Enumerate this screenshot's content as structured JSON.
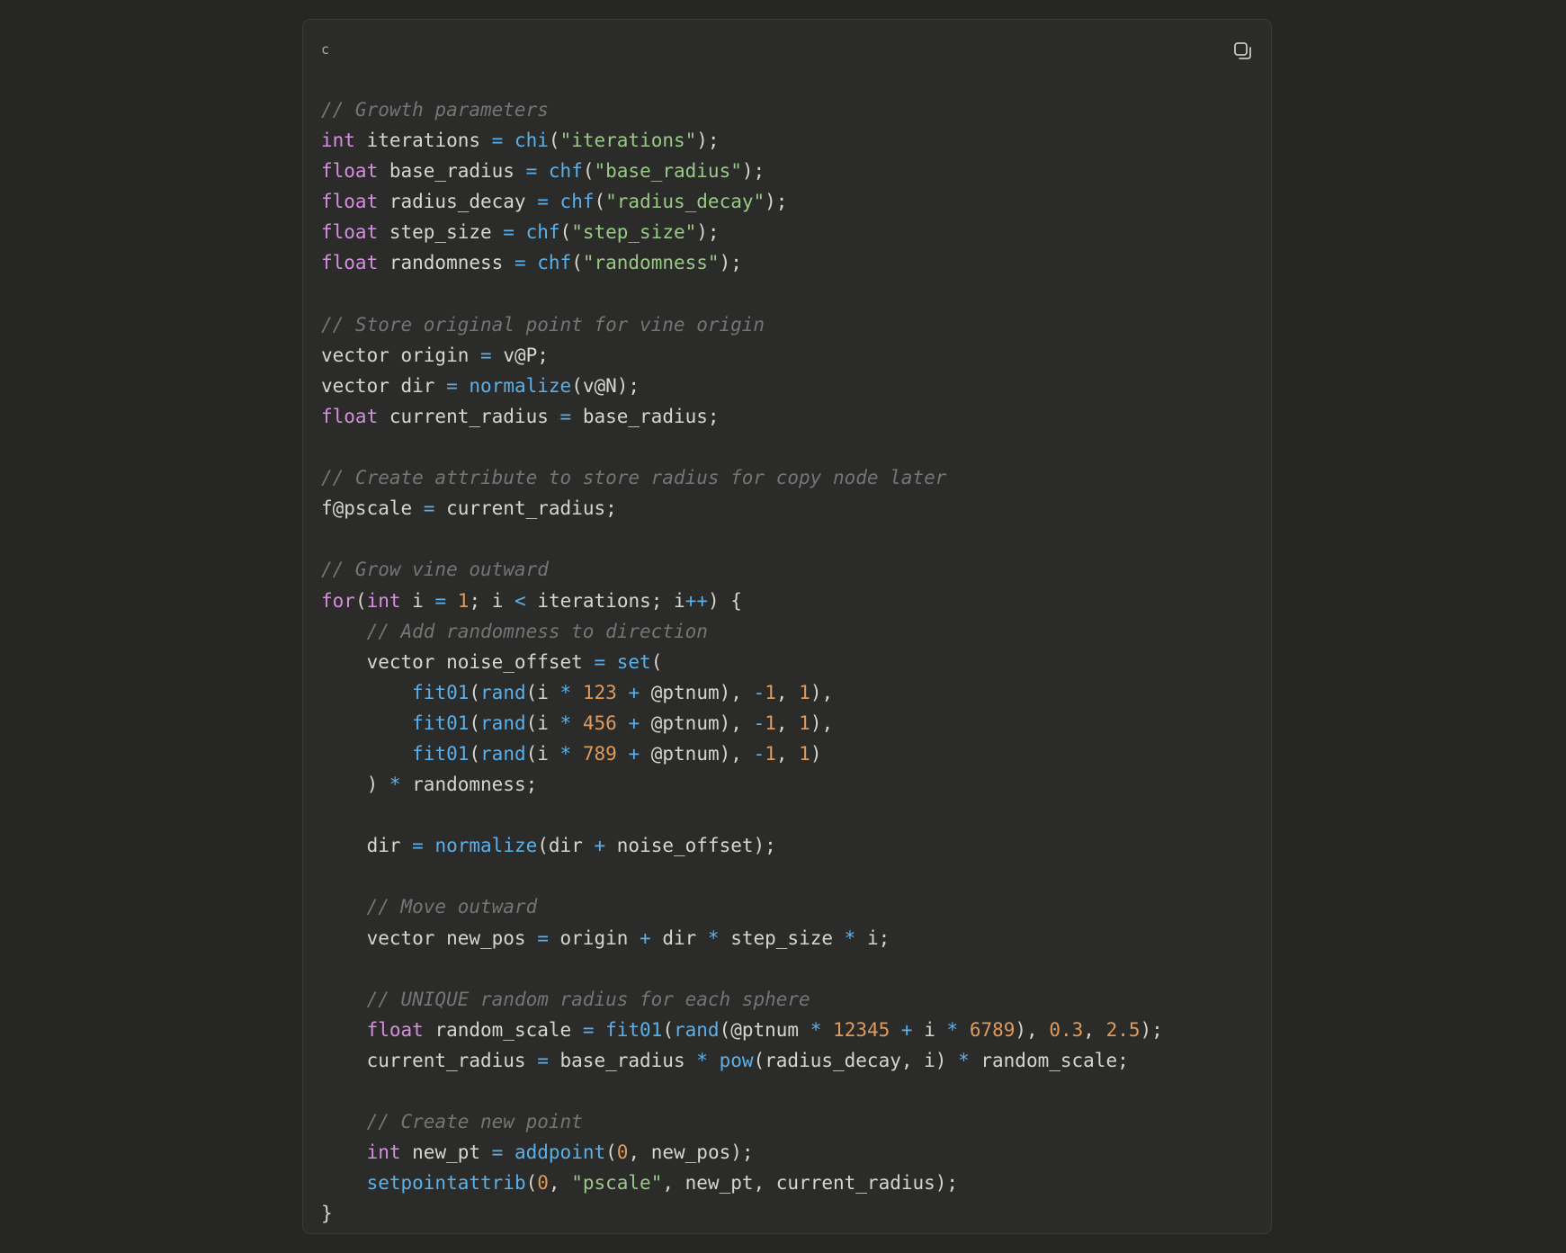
{
  "code_block": {
    "language": "c",
    "copy_icon": "copy-icon",
    "lines": [
      [
        {
          "t": "cm",
          "v": "// Growth parameters"
        }
      ],
      [
        {
          "t": "kw",
          "v": "int"
        },
        {
          "t": "pl",
          "v": " iterations "
        },
        {
          "t": "op",
          "v": "="
        },
        {
          "t": "pl",
          "v": " "
        },
        {
          "t": "fn",
          "v": "chi"
        },
        {
          "t": "pl",
          "v": "("
        },
        {
          "t": "st",
          "v": "\"iterations\""
        },
        {
          "t": "pl",
          "v": ");"
        }
      ],
      [
        {
          "t": "kw",
          "v": "float"
        },
        {
          "t": "pl",
          "v": " base_radius "
        },
        {
          "t": "op",
          "v": "="
        },
        {
          "t": "pl",
          "v": " "
        },
        {
          "t": "fn",
          "v": "chf"
        },
        {
          "t": "pl",
          "v": "("
        },
        {
          "t": "st",
          "v": "\"base_radius\""
        },
        {
          "t": "pl",
          "v": ");"
        }
      ],
      [
        {
          "t": "kw",
          "v": "float"
        },
        {
          "t": "pl",
          "v": " radius_decay "
        },
        {
          "t": "op",
          "v": "="
        },
        {
          "t": "pl",
          "v": " "
        },
        {
          "t": "fn",
          "v": "chf"
        },
        {
          "t": "pl",
          "v": "("
        },
        {
          "t": "st",
          "v": "\"radius_decay\""
        },
        {
          "t": "pl",
          "v": ");"
        }
      ],
      [
        {
          "t": "kw",
          "v": "float"
        },
        {
          "t": "pl",
          "v": " step_size "
        },
        {
          "t": "op",
          "v": "="
        },
        {
          "t": "pl",
          "v": " "
        },
        {
          "t": "fn",
          "v": "chf"
        },
        {
          "t": "pl",
          "v": "("
        },
        {
          "t": "st",
          "v": "\"step_size\""
        },
        {
          "t": "pl",
          "v": ");"
        }
      ],
      [
        {
          "t": "kw",
          "v": "float"
        },
        {
          "t": "pl",
          "v": " randomness "
        },
        {
          "t": "op",
          "v": "="
        },
        {
          "t": "pl",
          "v": " "
        },
        {
          "t": "fn",
          "v": "chf"
        },
        {
          "t": "pl",
          "v": "("
        },
        {
          "t": "st",
          "v": "\"randomness\""
        },
        {
          "t": "pl",
          "v": ");"
        }
      ],
      [],
      [
        {
          "t": "cm",
          "v": "// Store original point for vine origin"
        }
      ],
      [
        {
          "t": "pl",
          "v": "vector origin "
        },
        {
          "t": "op",
          "v": "="
        },
        {
          "t": "pl",
          "v": " v@P;"
        }
      ],
      [
        {
          "t": "pl",
          "v": "vector dir "
        },
        {
          "t": "op",
          "v": "="
        },
        {
          "t": "pl",
          "v": " "
        },
        {
          "t": "fn",
          "v": "normalize"
        },
        {
          "t": "pl",
          "v": "(v@N);"
        }
      ],
      [
        {
          "t": "kw",
          "v": "float"
        },
        {
          "t": "pl",
          "v": " current_radius "
        },
        {
          "t": "op",
          "v": "="
        },
        {
          "t": "pl",
          "v": " base_radius;"
        }
      ],
      [],
      [
        {
          "t": "cm",
          "v": "// Create attribute to store radius for copy node later"
        }
      ],
      [
        {
          "t": "pl",
          "v": "f@pscale "
        },
        {
          "t": "op",
          "v": "="
        },
        {
          "t": "pl",
          "v": " current_radius;"
        }
      ],
      [],
      [
        {
          "t": "cm",
          "v": "// Grow vine outward"
        }
      ],
      [
        {
          "t": "kw",
          "v": "for"
        },
        {
          "t": "pl",
          "v": "("
        },
        {
          "t": "kw",
          "v": "int"
        },
        {
          "t": "pl",
          "v": " i "
        },
        {
          "t": "op",
          "v": "="
        },
        {
          "t": "pl",
          "v": " "
        },
        {
          "t": "nm",
          "v": "1"
        },
        {
          "t": "pl",
          "v": "; i "
        },
        {
          "t": "op",
          "v": "<"
        },
        {
          "t": "pl",
          "v": " iterations; i"
        },
        {
          "t": "op",
          "v": "++"
        },
        {
          "t": "pl",
          "v": ") {"
        }
      ],
      [
        {
          "t": "pl",
          "v": "    "
        },
        {
          "t": "cm",
          "v": "// Add randomness to direction"
        }
      ],
      [
        {
          "t": "pl",
          "v": "    vector noise_offset "
        },
        {
          "t": "op",
          "v": "="
        },
        {
          "t": "pl",
          "v": " "
        },
        {
          "t": "fn",
          "v": "set"
        },
        {
          "t": "pl",
          "v": "("
        }
      ],
      [
        {
          "t": "pl",
          "v": "        "
        },
        {
          "t": "fn",
          "v": "fit01"
        },
        {
          "t": "pl",
          "v": "("
        },
        {
          "t": "fn",
          "v": "rand"
        },
        {
          "t": "pl",
          "v": "(i "
        },
        {
          "t": "op",
          "v": "*"
        },
        {
          "t": "pl",
          "v": " "
        },
        {
          "t": "nm",
          "v": "123"
        },
        {
          "t": "pl",
          "v": " "
        },
        {
          "t": "op",
          "v": "+"
        },
        {
          "t": "pl",
          "v": " @ptnum), "
        },
        {
          "t": "op",
          "v": "-"
        },
        {
          "t": "nm",
          "v": "1"
        },
        {
          "t": "pl",
          "v": ", "
        },
        {
          "t": "nm",
          "v": "1"
        },
        {
          "t": "pl",
          "v": "),"
        }
      ],
      [
        {
          "t": "pl",
          "v": "        "
        },
        {
          "t": "fn",
          "v": "fit01"
        },
        {
          "t": "pl",
          "v": "("
        },
        {
          "t": "fn",
          "v": "rand"
        },
        {
          "t": "pl",
          "v": "(i "
        },
        {
          "t": "op",
          "v": "*"
        },
        {
          "t": "pl",
          "v": " "
        },
        {
          "t": "nm",
          "v": "456"
        },
        {
          "t": "pl",
          "v": " "
        },
        {
          "t": "op",
          "v": "+"
        },
        {
          "t": "pl",
          "v": " @ptnum), "
        },
        {
          "t": "op",
          "v": "-"
        },
        {
          "t": "nm",
          "v": "1"
        },
        {
          "t": "pl",
          "v": ", "
        },
        {
          "t": "nm",
          "v": "1"
        },
        {
          "t": "pl",
          "v": "),"
        }
      ],
      [
        {
          "t": "pl",
          "v": "        "
        },
        {
          "t": "fn",
          "v": "fit01"
        },
        {
          "t": "pl",
          "v": "("
        },
        {
          "t": "fn",
          "v": "rand"
        },
        {
          "t": "pl",
          "v": "(i "
        },
        {
          "t": "op",
          "v": "*"
        },
        {
          "t": "pl",
          "v": " "
        },
        {
          "t": "nm",
          "v": "789"
        },
        {
          "t": "pl",
          "v": " "
        },
        {
          "t": "op",
          "v": "+"
        },
        {
          "t": "pl",
          "v": " @ptnum), "
        },
        {
          "t": "op",
          "v": "-"
        },
        {
          "t": "nm",
          "v": "1"
        },
        {
          "t": "pl",
          "v": ", "
        },
        {
          "t": "nm",
          "v": "1"
        },
        {
          "t": "pl",
          "v": ")"
        }
      ],
      [
        {
          "t": "pl",
          "v": "    ) "
        },
        {
          "t": "op",
          "v": "*"
        },
        {
          "t": "pl",
          "v": " randomness;"
        }
      ],
      [],
      [
        {
          "t": "pl",
          "v": "    dir "
        },
        {
          "t": "op",
          "v": "="
        },
        {
          "t": "pl",
          "v": " "
        },
        {
          "t": "fn",
          "v": "normalize"
        },
        {
          "t": "pl",
          "v": "(dir "
        },
        {
          "t": "op",
          "v": "+"
        },
        {
          "t": "pl",
          "v": " noise_offset);"
        }
      ],
      [],
      [
        {
          "t": "pl",
          "v": "    "
        },
        {
          "t": "cm",
          "v": "// Move outward"
        }
      ],
      [
        {
          "t": "pl",
          "v": "    vector new_pos "
        },
        {
          "t": "op",
          "v": "="
        },
        {
          "t": "pl",
          "v": " origin "
        },
        {
          "t": "op",
          "v": "+"
        },
        {
          "t": "pl",
          "v": " dir "
        },
        {
          "t": "op",
          "v": "*"
        },
        {
          "t": "pl",
          "v": " step_size "
        },
        {
          "t": "op",
          "v": "*"
        },
        {
          "t": "pl",
          "v": " i;"
        }
      ],
      [],
      [
        {
          "t": "pl",
          "v": "    "
        },
        {
          "t": "cm",
          "v": "// UNIQUE random radius for each sphere"
        }
      ],
      [
        {
          "t": "pl",
          "v": "    "
        },
        {
          "t": "kw",
          "v": "float"
        },
        {
          "t": "pl",
          "v": " random_scale "
        },
        {
          "t": "op",
          "v": "="
        },
        {
          "t": "pl",
          "v": " "
        },
        {
          "t": "fn",
          "v": "fit01"
        },
        {
          "t": "pl",
          "v": "("
        },
        {
          "t": "fn",
          "v": "rand"
        },
        {
          "t": "pl",
          "v": "(@ptnum "
        },
        {
          "t": "op",
          "v": "*"
        },
        {
          "t": "pl",
          "v": " "
        },
        {
          "t": "nm",
          "v": "12345"
        },
        {
          "t": "pl",
          "v": " "
        },
        {
          "t": "op",
          "v": "+"
        },
        {
          "t": "pl",
          "v": " i "
        },
        {
          "t": "op",
          "v": "*"
        },
        {
          "t": "pl",
          "v": " "
        },
        {
          "t": "nm",
          "v": "6789"
        },
        {
          "t": "pl",
          "v": "), "
        },
        {
          "t": "nm",
          "v": "0.3"
        },
        {
          "t": "pl",
          "v": ", "
        },
        {
          "t": "nm",
          "v": "2.5"
        },
        {
          "t": "pl",
          "v": ");"
        }
      ],
      [
        {
          "t": "pl",
          "v": "    current_radius "
        },
        {
          "t": "op",
          "v": "="
        },
        {
          "t": "pl",
          "v": " base_radius "
        },
        {
          "t": "op",
          "v": "*"
        },
        {
          "t": "pl",
          "v": " "
        },
        {
          "t": "fn",
          "v": "pow"
        },
        {
          "t": "pl",
          "v": "(radius_decay, i) "
        },
        {
          "t": "op",
          "v": "*"
        },
        {
          "t": "pl",
          "v": " random_scale;"
        }
      ],
      [],
      [
        {
          "t": "pl",
          "v": "    "
        },
        {
          "t": "cm",
          "v": "// Create new point"
        }
      ],
      [
        {
          "t": "pl",
          "v": "    "
        },
        {
          "t": "kw",
          "v": "int"
        },
        {
          "t": "pl",
          "v": " new_pt "
        },
        {
          "t": "op",
          "v": "="
        },
        {
          "t": "pl",
          "v": " "
        },
        {
          "t": "fn",
          "v": "addpoint"
        },
        {
          "t": "pl",
          "v": "("
        },
        {
          "t": "nm",
          "v": "0"
        },
        {
          "t": "pl",
          "v": ", new_pos);"
        }
      ],
      [
        {
          "t": "pl",
          "v": "    "
        },
        {
          "t": "fn",
          "v": "setpointattrib"
        },
        {
          "t": "pl",
          "v": "("
        },
        {
          "t": "nm",
          "v": "0"
        },
        {
          "t": "pl",
          "v": ", "
        },
        {
          "t": "st",
          "v": "\"pscale\""
        },
        {
          "t": "pl",
          "v": ", new_pt, current_radius);"
        }
      ],
      [
        {
          "t": "pl",
          "v": "}"
        }
      ]
    ]
  },
  "colors": {
    "page_background": "#262625",
    "card_background": "#2b2b29",
    "keyword": "#d58fe0",
    "function": "#5cb0ea",
    "string": "#9ac889",
    "number": "#df9b5c",
    "comment": "#727675",
    "plain": "#d6d6cf"
  }
}
